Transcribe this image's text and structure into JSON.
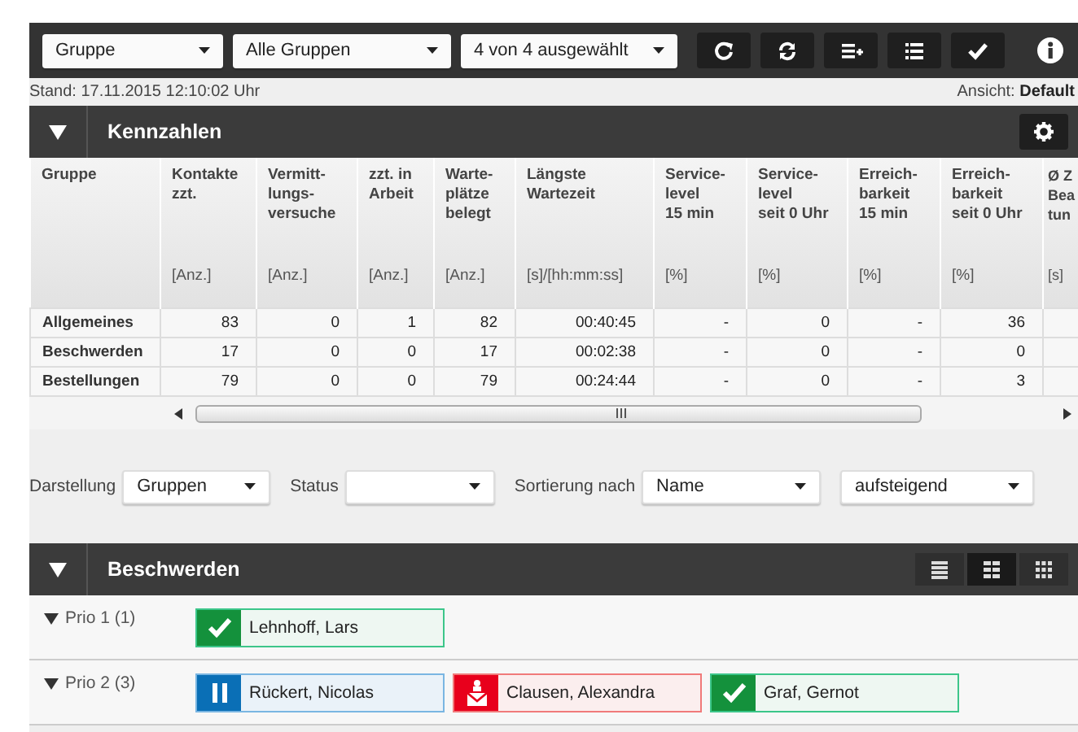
{
  "toolbar": {
    "selects": [
      {
        "value": "Gruppe"
      },
      {
        "value": "Alle Gruppen"
      },
      {
        "value": "4 von 4 ausgewählt"
      }
    ],
    "buttons": [
      {
        "kind": "refresh"
      },
      {
        "kind": "sync"
      },
      {
        "kind": "add-list"
      },
      {
        "kind": "list"
      },
      {
        "kind": "check"
      }
    ]
  },
  "status": {
    "timestamp": "Stand: 17.11.2015 12:10:02 Uhr",
    "view_label": "Ansicht:",
    "view_value": "Default"
  },
  "kennzahlen": {
    "title": "Kennzahlen",
    "expanded": true,
    "columns": [
      {
        "label": "Gruppe"
      },
      {
        "label": "Kontakte\nzzt.",
        "unit": "[Anz.]"
      },
      {
        "label": "Vermitt-\nlungs-\nversuche",
        "unit": "[Anz.]"
      },
      {
        "label": "zzt. in\nArbeit",
        "unit": "[Anz.]"
      },
      {
        "label": "Warte-\nplätze\nbelegt",
        "unit": "[Anz.]"
      },
      {
        "label": "Längste\nWartezeit",
        "unit": "[s]/[hh:mm:ss]"
      },
      {
        "label": "Service-\nlevel\n15 min",
        "unit": "[%]"
      },
      {
        "label": "Service-\nlevel\nseit 0 Uhr",
        "unit": "[%]"
      },
      {
        "label": "Erreich-\nbarkeit\n15 min",
        "unit": "[%]"
      },
      {
        "label": "Erreich-\nbarkeit\nseit 0 Uhr",
        "unit": "[%]"
      },
      {
        "label": "Ø Z\nBea\ntun",
        "unit": "[s]"
      }
    ],
    "rows": [
      [
        "Allgemeines",
        "83",
        "0",
        "1",
        "82",
        "00:40:45",
        "-",
        "0",
        "-",
        "36"
      ],
      [
        "Beschwerden",
        "17",
        "0",
        "0",
        "17",
        "00:02:38",
        "-",
        "0",
        "-",
        "0"
      ],
      [
        "Bestellungen",
        "79",
        "0",
        "0",
        "79",
        "00:24:44",
        "-",
        "0",
        "-",
        "3"
      ]
    ]
  },
  "filters": [
    {
      "label": "Darstellung",
      "value": "Gruppen"
    },
    {
      "label": "Status"
    },
    {
      "label": "Sortierung nach",
      "value": "Name"
    },
    {
      "value": "aufsteigend"
    }
  ],
  "beschwerden": {
    "title": "Beschwerden",
    "expanded": true,
    "views": [
      {
        "kind": "rows",
        "selected": false
      },
      {
        "kind": "grid",
        "selected": true
      },
      {
        "kind": "dense",
        "selected": false
      }
    ],
    "groups": [
      {
        "label": "Prio 1 (1)",
        "expanded": true,
        "agents": [
          {
            "name": "Lehnhoff, Lars",
            "kind": "available"
          }
        ]
      },
      {
        "label": "Prio 2 (3)",
        "expanded": true,
        "agents": [
          {
            "name": "Rückert, Nicolas",
            "kind": "paused"
          },
          {
            "name": "Clausen, Alexandra",
            "kind": "mail"
          },
          {
            "name": "Graf, Gernot",
            "kind": "available"
          }
        ]
      }
    ]
  }
}
